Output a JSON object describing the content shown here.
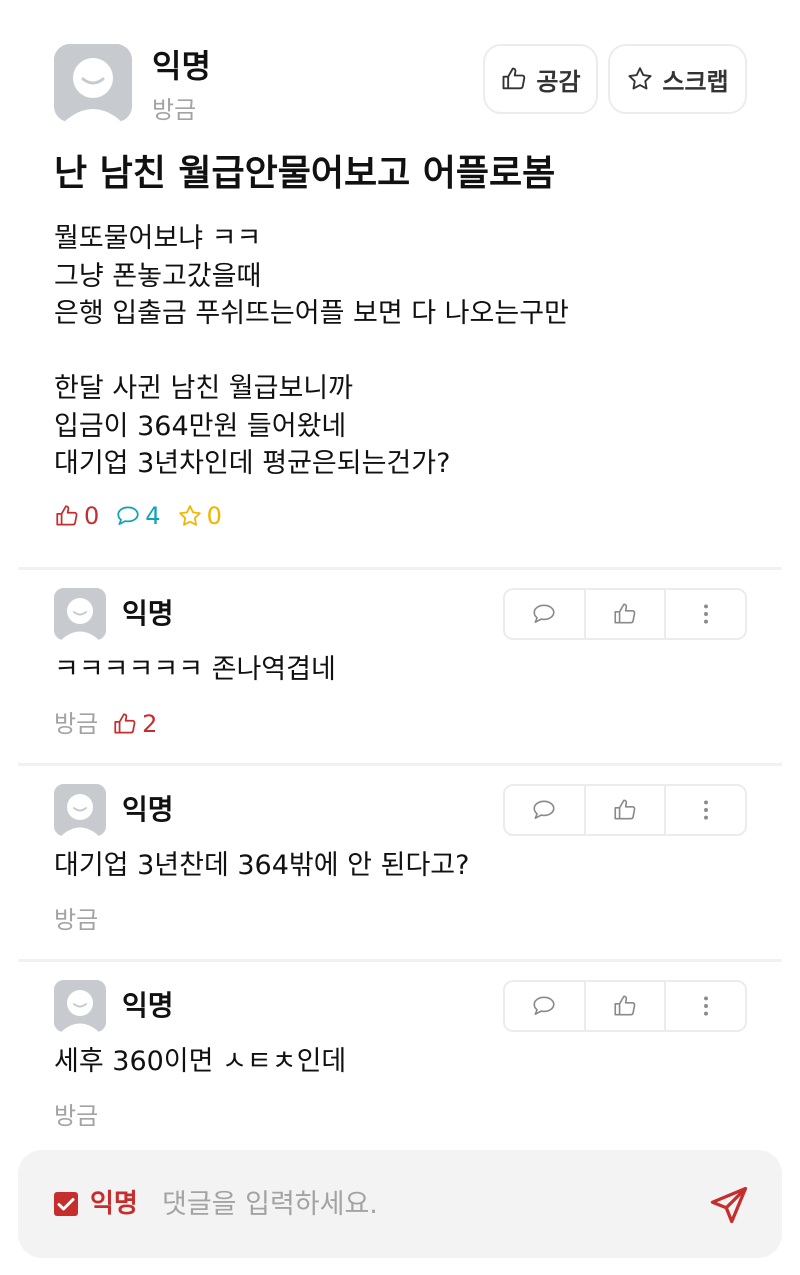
{
  "post": {
    "author": "익명",
    "time": "방금",
    "like_label": "공감",
    "scrap_label": "스크랩",
    "title": "난 남친 월급안물어보고 어플로봄",
    "body_lines": [
      "뭘또물어보냐 ㅋㅋ",
      "그냥 폰놓고갔을때",
      "은행 입출금 푸쉬뜨는어플 보면 다 나오는구만",
      "",
      "한달 사귄 남친 월급보니까",
      "입금이 364만원 들어왔네",
      "대기업 3년차인데 평균은되는건가?"
    ],
    "stats": {
      "likes": "0",
      "comments": "4",
      "scraps": "0"
    }
  },
  "comments": [
    {
      "author": "익명",
      "text": "ㅋㅋㅋㅋㅋㅋ 존나역겹네",
      "time": "방금",
      "likes": "2"
    },
    {
      "author": "익명",
      "text": "대기업 3년찬데 364밖에 안 된다고?",
      "time": "방금"
    },
    {
      "author": "익명",
      "text": "세후 360이면 ㅅㅌㅊ인데",
      "time": "방금"
    }
  ],
  "composer": {
    "anonymous_label": "익명",
    "anonymous_checked": true,
    "placeholder": "댓글을 입력하세요."
  },
  "colors": {
    "accent_red": "#c62e2e",
    "comment_teal": "#0fa3b8",
    "scrap_yellow": "#f2b400",
    "muted_gray": "#a3a3a3"
  },
  "icons": [
    "thumbs-up-icon",
    "star-icon",
    "speech-bubble-icon",
    "more-vertical-icon",
    "send-icon",
    "checkbox-icon",
    "avatar-icon"
  ]
}
